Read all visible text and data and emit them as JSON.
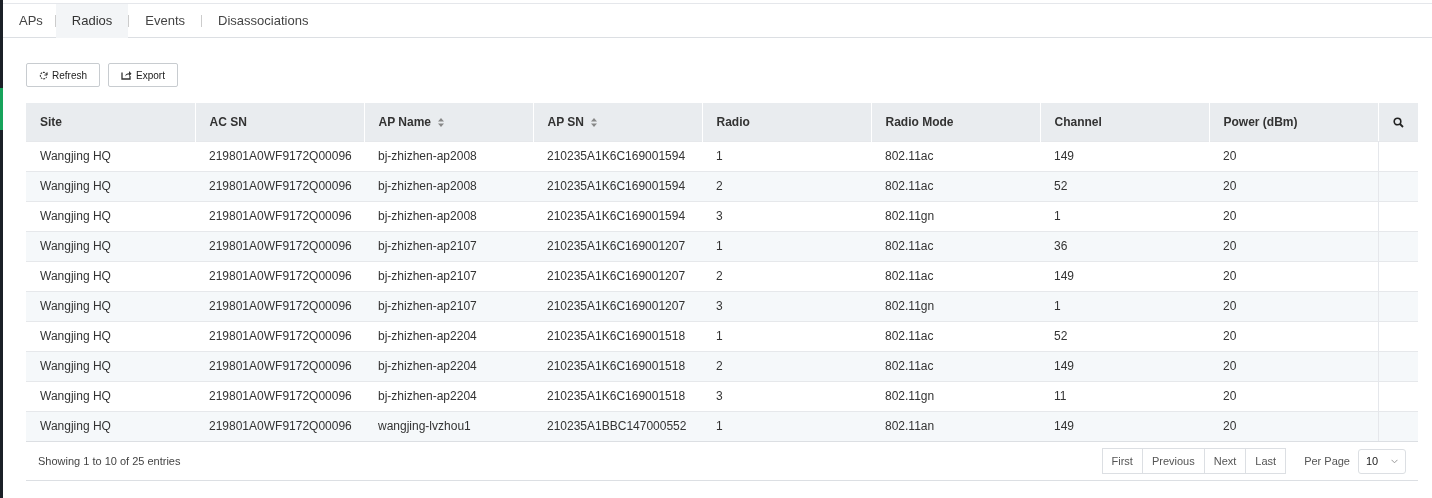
{
  "tabs": [
    {
      "label": "APs",
      "selected": false
    },
    {
      "label": "Radios",
      "selected": true
    },
    {
      "label": "Events",
      "selected": false
    },
    {
      "label": "Disassociations",
      "selected": false
    }
  ],
  "toolbar": [
    {
      "label": "Refresh",
      "kind": "refresh"
    },
    {
      "label": "Export",
      "kind": "export"
    }
  ],
  "table": {
    "columns": [
      {
        "label": "Site",
        "sortable": false
      },
      {
        "label": "AC SN",
        "sortable": false
      },
      {
        "label": "AP Name",
        "sortable": true
      },
      {
        "label": "AP SN",
        "sortable": true
      },
      {
        "label": "Radio",
        "sortable": false
      },
      {
        "label": "Radio Mode",
        "sortable": false
      },
      {
        "label": "Channel",
        "sortable": false
      },
      {
        "label": "Power (dBm)",
        "sortable": false
      }
    ],
    "rows": [
      [
        "Wangjing HQ",
        "219801A0WF9172Q00096",
        "bj-zhizhen-ap2008",
        "210235A1K6C169001594",
        "1",
        "802.11ac",
        "149",
        "20"
      ],
      [
        "Wangjing HQ",
        "219801A0WF9172Q00096",
        "bj-zhizhen-ap2008",
        "210235A1K6C169001594",
        "2",
        "802.11ac",
        "52",
        "20"
      ],
      [
        "Wangjing HQ",
        "219801A0WF9172Q00096",
        "bj-zhizhen-ap2008",
        "210235A1K6C169001594",
        "3",
        "802.11gn",
        "1",
        "20"
      ],
      [
        "Wangjing HQ",
        "219801A0WF9172Q00096",
        "bj-zhizhen-ap2107",
        "210235A1K6C169001207",
        "1",
        "802.11ac",
        "36",
        "20"
      ],
      [
        "Wangjing HQ",
        "219801A0WF9172Q00096",
        "bj-zhizhen-ap2107",
        "210235A1K6C169001207",
        "2",
        "802.11ac",
        "149",
        "20"
      ],
      [
        "Wangjing HQ",
        "219801A0WF9172Q00096",
        "bj-zhizhen-ap2107",
        "210235A1K6C169001207",
        "3",
        "802.11gn",
        "1",
        "20"
      ],
      [
        "Wangjing HQ",
        "219801A0WF9172Q00096",
        "bj-zhizhen-ap2204",
        "210235A1K6C169001518",
        "1",
        "802.11ac",
        "52",
        "20"
      ],
      [
        "Wangjing HQ",
        "219801A0WF9172Q00096",
        "bj-zhizhen-ap2204",
        "210235A1K6C169001518",
        "2",
        "802.11ac",
        "149",
        "20"
      ],
      [
        "Wangjing HQ",
        "219801A0WF9172Q00096",
        "bj-zhizhen-ap2204",
        "210235A1K6C169001518",
        "3",
        "802.11gn",
        "11",
        "20"
      ],
      [
        "Wangjing HQ",
        "219801A0WF9172Q00096",
        "wangjing-lvzhou1",
        "210235A1BBC147000552",
        "1",
        "802.11an",
        "149",
        "20"
      ]
    ]
  },
  "footer": {
    "summary": "Showing 1 to 10 of 25 entries",
    "pager": [
      "First",
      "Previous",
      "Next",
      "Last"
    ],
    "per_page_label": "Per Page",
    "per_page": "10"
  }
}
